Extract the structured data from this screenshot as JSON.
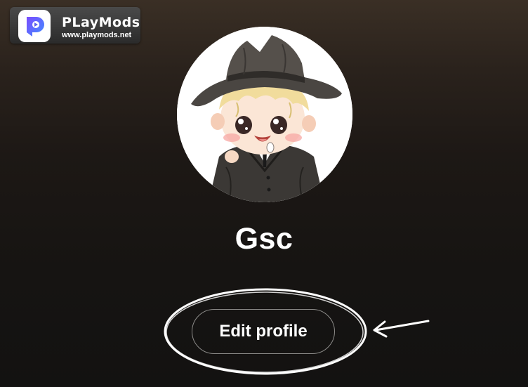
{
  "watermark": {
    "title": "PLayMods",
    "url": "www.playmods.net",
    "logo_icon": "playmods-logo-icon"
  },
  "profile": {
    "avatar_description_icon": "profile-avatar",
    "username": "Gsc",
    "edit_button_label": "Edit profile"
  },
  "colors": {
    "background_top": "#3a2f25",
    "background_bottom": "#131211",
    "button_border": "#8b8a88",
    "annotation": "#ffffff",
    "logo_accent": "#5b5ff0"
  }
}
